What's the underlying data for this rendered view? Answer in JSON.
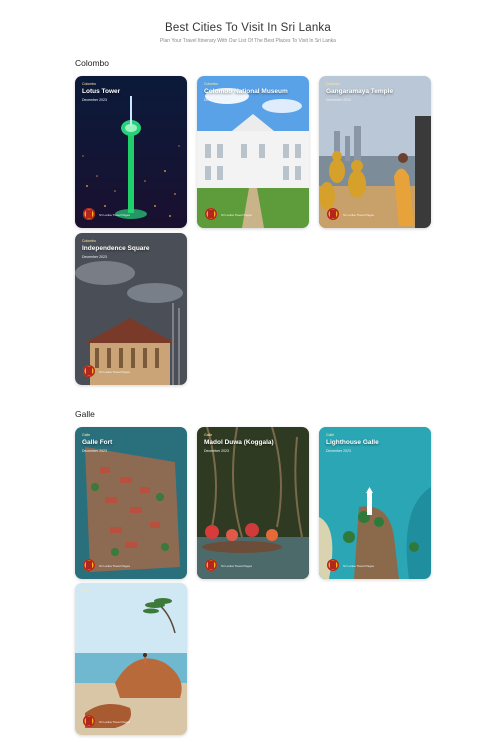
{
  "header": {
    "title": "Best Cities To Visit In Sri Lanka",
    "subtitle": "Plan Your Travel Itinerary With Our List Of The Best Places To Visit In Sri Lanka"
  },
  "sections": [
    {
      "title": "Colombo",
      "cards": [
        {
          "name": "Lotus Tower",
          "date": "December 2023",
          "category": "Colombo"
        },
        {
          "name": "Colombo National Museum",
          "date": "December 2023",
          "category": "Colombo"
        },
        {
          "name": "Gangaramaya Temple",
          "date": "December 2023",
          "category": "Colombo"
        },
        {
          "name": "Independence Square",
          "date": "December 2023",
          "category": "Colombo"
        }
      ]
    },
    {
      "title": "Galle",
      "cards": [
        {
          "name": "Galle Fort",
          "date": "December 2023",
          "category": "Galle"
        },
        {
          "name": "Madol Duwa (Koggala)",
          "date": "December 2023",
          "category": "Galle"
        },
        {
          "name": "Lighthouse Galle",
          "date": "December 2023",
          "category": "Galle"
        },
        {
          "name": "",
          "date": "",
          "category": "Galle"
        }
      ]
    }
  ],
  "badge_text": "Sri Lanka Travel Pages"
}
